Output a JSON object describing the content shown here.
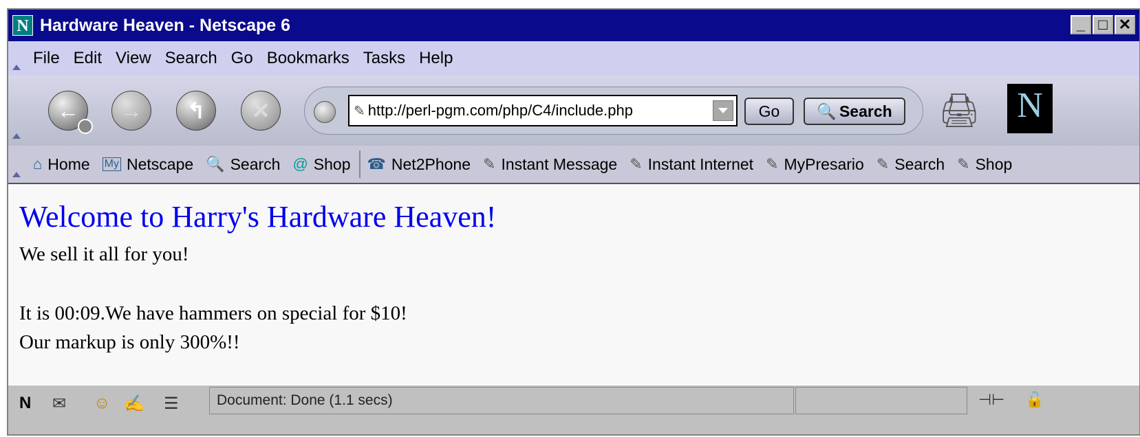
{
  "window": {
    "title": "Hardware Heaven - Netscape 6",
    "logo_letter": "N"
  },
  "menu": [
    "File",
    "Edit",
    "View",
    "Search",
    "Go",
    "Bookmarks",
    "Tasks",
    "Help"
  ],
  "navigation": {
    "url": "http://perl-pgm.com/php/C4/include.php",
    "go_label": "Go",
    "search_label": "Search",
    "brand_letter": "N"
  },
  "personal_toolbar": [
    "Home",
    "Netscape",
    "Search",
    "Shop",
    "Net2Phone",
    "Instant Message",
    "Instant Internet",
    "MyPresario",
    "Search",
    "Shop"
  ],
  "page": {
    "heading": "Welcome to Harry's Hardware Heaven!",
    "line1": "We sell it all for you!",
    "line2": "It is 00:09.We have hammers on special for $10!",
    "line3": "Our markup is only 300%!!"
  },
  "status": {
    "text": "Document: Done (1.1 secs)"
  },
  "colors": {
    "title_bar": "#0a0a8c",
    "menu_bg": "#cfd0f0",
    "link_blue": "#0000ee"
  }
}
